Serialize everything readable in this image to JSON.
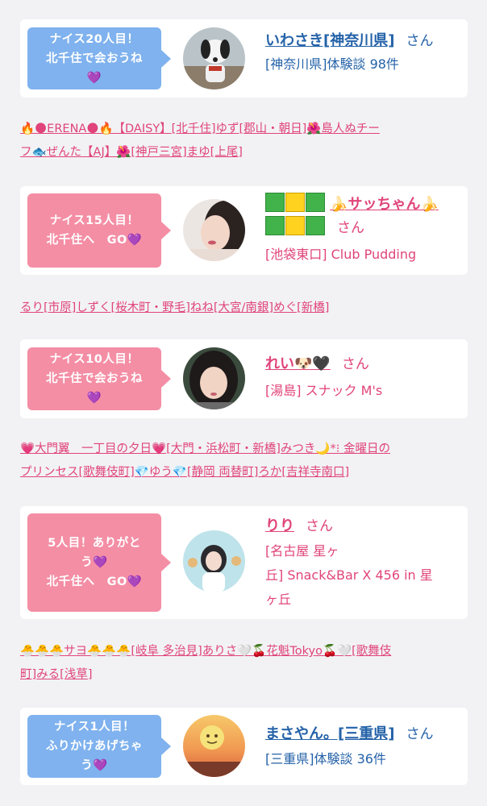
{
  "cards": [
    {
      "bubble": "ナイス20人目！\n北千住で会おうね\n💜",
      "name": "いわさき[神奈川県]",
      "san": "さん",
      "shop": "[神奈川県]体験談 98件"
    },
    {
      "bubble": "ナイス15人目！\n北千住へ　GO💜",
      "name": "🍌サッちゃん🍌",
      "san": "さん",
      "shop": "[池袋東口] Club Pudding"
    },
    {
      "bubble": "ナイス10人目！\n北千住で会おうね\n💜",
      "name": "れい🐶🖤",
      "san": "さん",
      "shop": "[湯島] スナック M's"
    },
    {
      "bubble": "5人目！ありがと\nう💜\n北千住へ　GO💜",
      "name": "りり",
      "san": "さん",
      "shop": "[名古屋 星ヶ\n丘] Snack&Bar X 456 in 星\nヶ丘"
    },
    {
      "bubble": "ナイス1人目！\nふりかけあげちゃ\nう💜",
      "name": "まさやん。[三重県]",
      "san": "さん",
      "shop": "[三重県]体験談 36件"
    }
  ],
  "link_rows": [
    {
      "line1": [
        "🔥🌑ERENA🌑🔥【DAISY】",
        "[北千住]",
        "ゆず",
        "[郡山・朝日]",
        "🌺島人ぬチー"
      ],
      "line2": [
        "フ🐟ぜんた【AJ】🌺",
        "[神戸三宮]",
        "まゆ",
        "[上尾]"
      ]
    },
    {
      "line1": [
        "るり",
        "[市原]",
        "しずく",
        "[桜木町・野毛]",
        "ねね",
        "[大宮/南銀]",
        "めぐ",
        "[新橋]"
      ]
    },
    {
      "line1": [
        "💗大門翼　一丁目の夕日💗",
        "[大門・浜松町・新橋]",
        "みつき🌙*⁝ 金曜日の"
      ],
      "line2": [
        "プリンセス",
        "[歌舞伎町]",
        "💎ゆう💎",
        "[静岡 両替町]",
        "ろか",
        "[吉祥寺南口]"
      ]
    },
    {
      "line1": [
        "🐣🐣🐣サヨ🐣🐣🐣",
        "[岐阜 多治見]",
        "ありさ🤍🍒花魁Tokyo🍒🤍",
        "[歌舞伎"
      ],
      "line2": [
        "町]",
        "みる",
        "[浅草]"
      ]
    }
  ],
  "colors": {
    "bubble_blue": "#7fb2ee",
    "bubble_pink": "#f48ea5",
    "link_blue": "#2462a8",
    "link_pink": "#e0447a",
    "background": "#f2f2f4"
  }
}
